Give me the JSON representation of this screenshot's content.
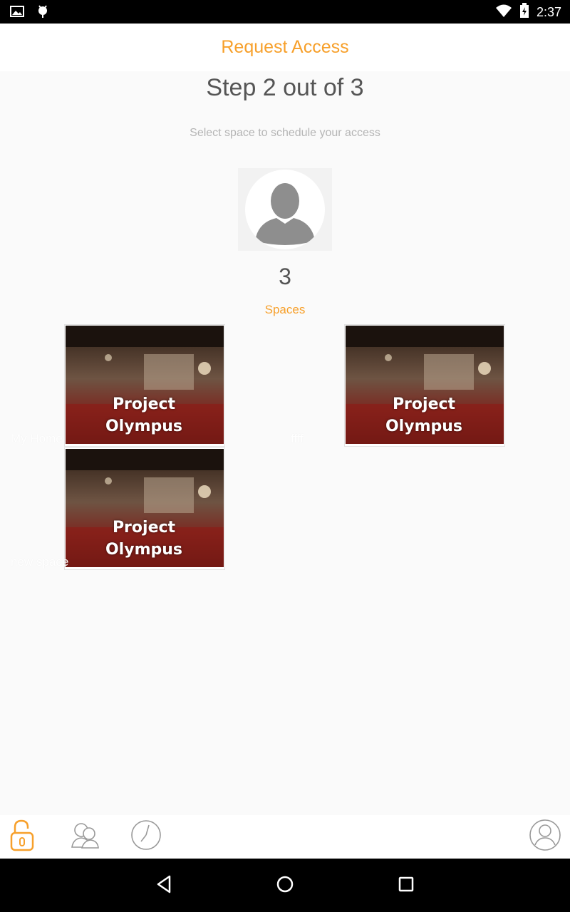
{
  "status_bar": {
    "time": "2:37",
    "icons": [
      "image-icon",
      "android-debug-icon",
      "wifi-icon",
      "battery-charging-icon"
    ]
  },
  "app_bar": {
    "title": "Request Access"
  },
  "step": {
    "text": "Step 2 out of 3",
    "subtitle": "Select space to schedule your access"
  },
  "summary": {
    "count": "3",
    "label": "Spaces"
  },
  "spaces": [
    {
      "name": "My Home",
      "image_text_line1": "Project",
      "image_text_line2": "Olympus"
    },
    {
      "name": "ffff",
      "image_text_line1": "Project",
      "image_text_line2": "Olympus"
    },
    {
      "name": "new space",
      "image_text_line1": "Project",
      "image_text_line2": "Olympus"
    }
  ],
  "bottom_bar": {
    "items": [
      "unlock-icon",
      "users-icon",
      "clock-icon",
      "profile-icon"
    ],
    "accent": "#f7a02b"
  },
  "colors": {
    "accent": "#f7a02b",
    "text": "#555555",
    "muted": "#b5b5b5"
  }
}
